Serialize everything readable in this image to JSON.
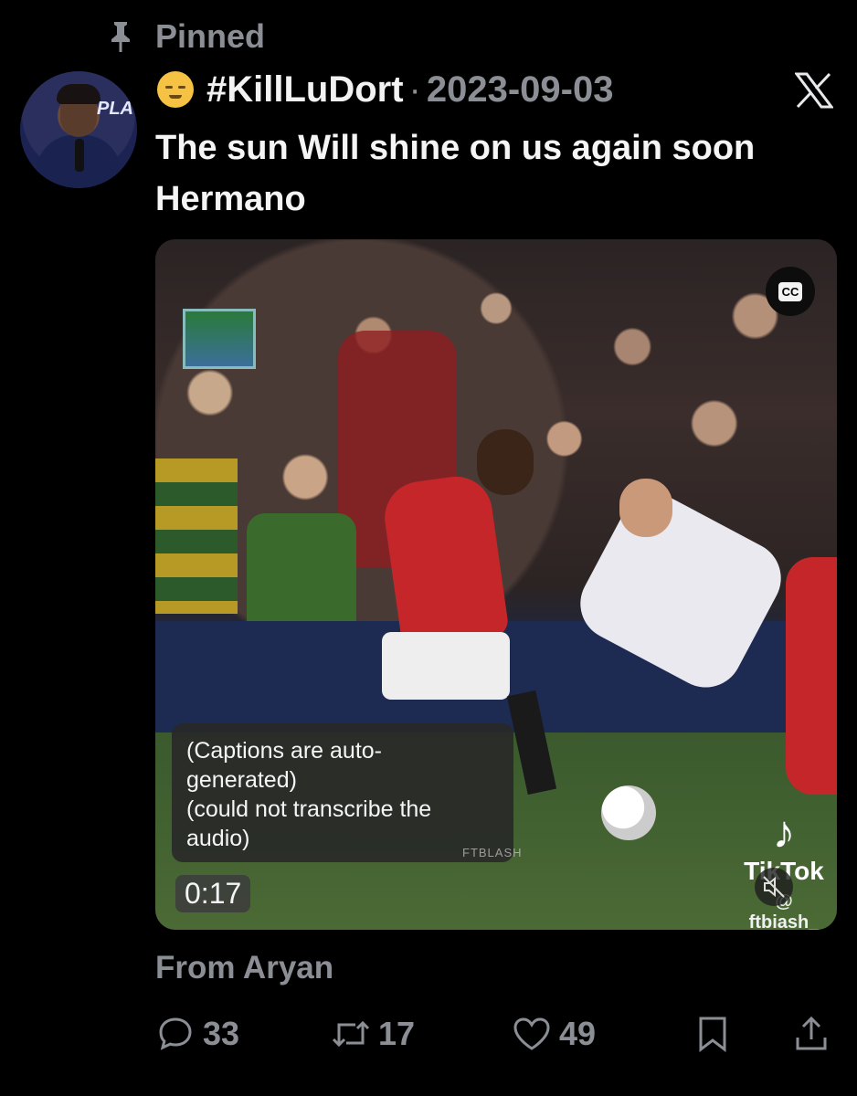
{
  "pinned": {
    "label": "Pinned",
    "icon": "pin-icon"
  },
  "author": {
    "display_name": "#KillLuDort",
    "separator": "·",
    "date": "2023-09-03",
    "emoji_icon": "sad-face-icon"
  },
  "platform_icon": "x-logo-icon",
  "tweet": {
    "text": "The sun Will shine on us again soon Hermano"
  },
  "video": {
    "captions_lines": [
      "(Captions are auto-",
      "generated)",
      "(could not transcribe the",
      "audio)"
    ],
    "time": "0:17",
    "cc_label": "CC",
    "watermark": "FTBLASH",
    "tiktok_brand": "TikTok",
    "tiktok_handle": "@ ftbiash_"
  },
  "source": {
    "label": "From Aryan"
  },
  "actions": {
    "replies": "33",
    "retweets": "17",
    "likes": "49"
  },
  "colors": {
    "background": "#000000",
    "text": "#e7e9ea",
    "muted": "#8b8f95"
  }
}
